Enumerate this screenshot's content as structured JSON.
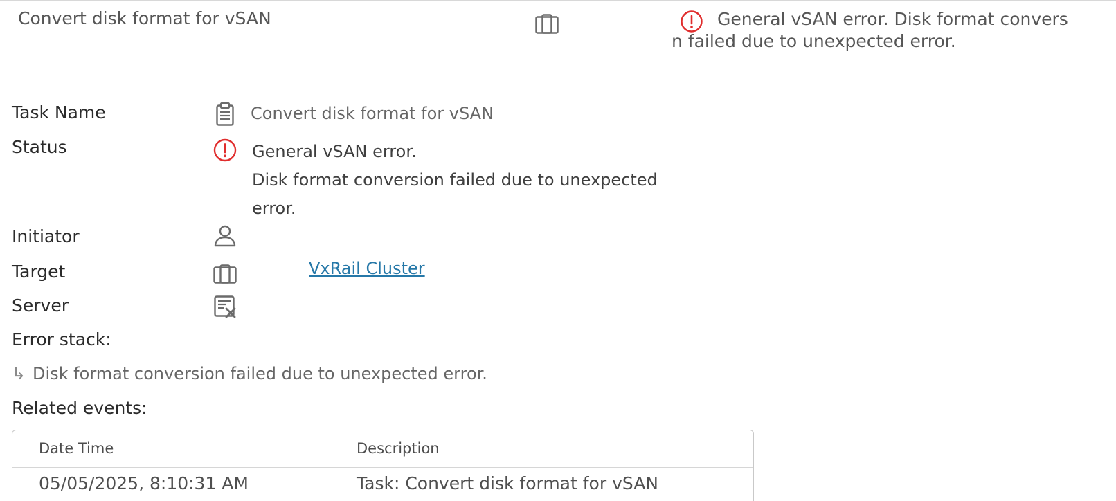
{
  "task_row": {
    "name": "Convert disk format for vSAN",
    "status_line1": "General vSAN error. Disk format convers",
    "status_line2": "n failed due to unexpected error."
  },
  "details": {
    "task_name_label": "Task Name",
    "task_name_value": "Convert disk format for vSAN",
    "status_label": "Status",
    "status_lines": [
      "General vSAN error.",
      "Disk format conversion failed due to unexpected",
      "error."
    ],
    "initiator_label": "Initiator",
    "target_label": "Target",
    "target_value": "VxRail Cluster",
    "server_label": "Server",
    "error_stack_label": "Error stack:",
    "error_stack_items": [
      "Disk format conversion failed due to unexpected error."
    ],
    "related_events_label": "Related events:"
  },
  "events_table": {
    "columns": [
      "Date Time",
      "Description"
    ],
    "rows": [
      [
        "05/05/2025, 8:10:31 AM",
        "Task: Convert disk format for vSAN"
      ]
    ]
  },
  "icons": {
    "task": "clipboard-icon",
    "status": "error-circle-icon",
    "initiator": "user-icon",
    "target": "cluster-icon",
    "server": "server-error-icon",
    "stack_arrow": "subdirectory-arrow-icon"
  },
  "colors": {
    "error": "#e02d2d",
    "link": "#2678a8",
    "icon_gray": "#6b6b6b"
  }
}
